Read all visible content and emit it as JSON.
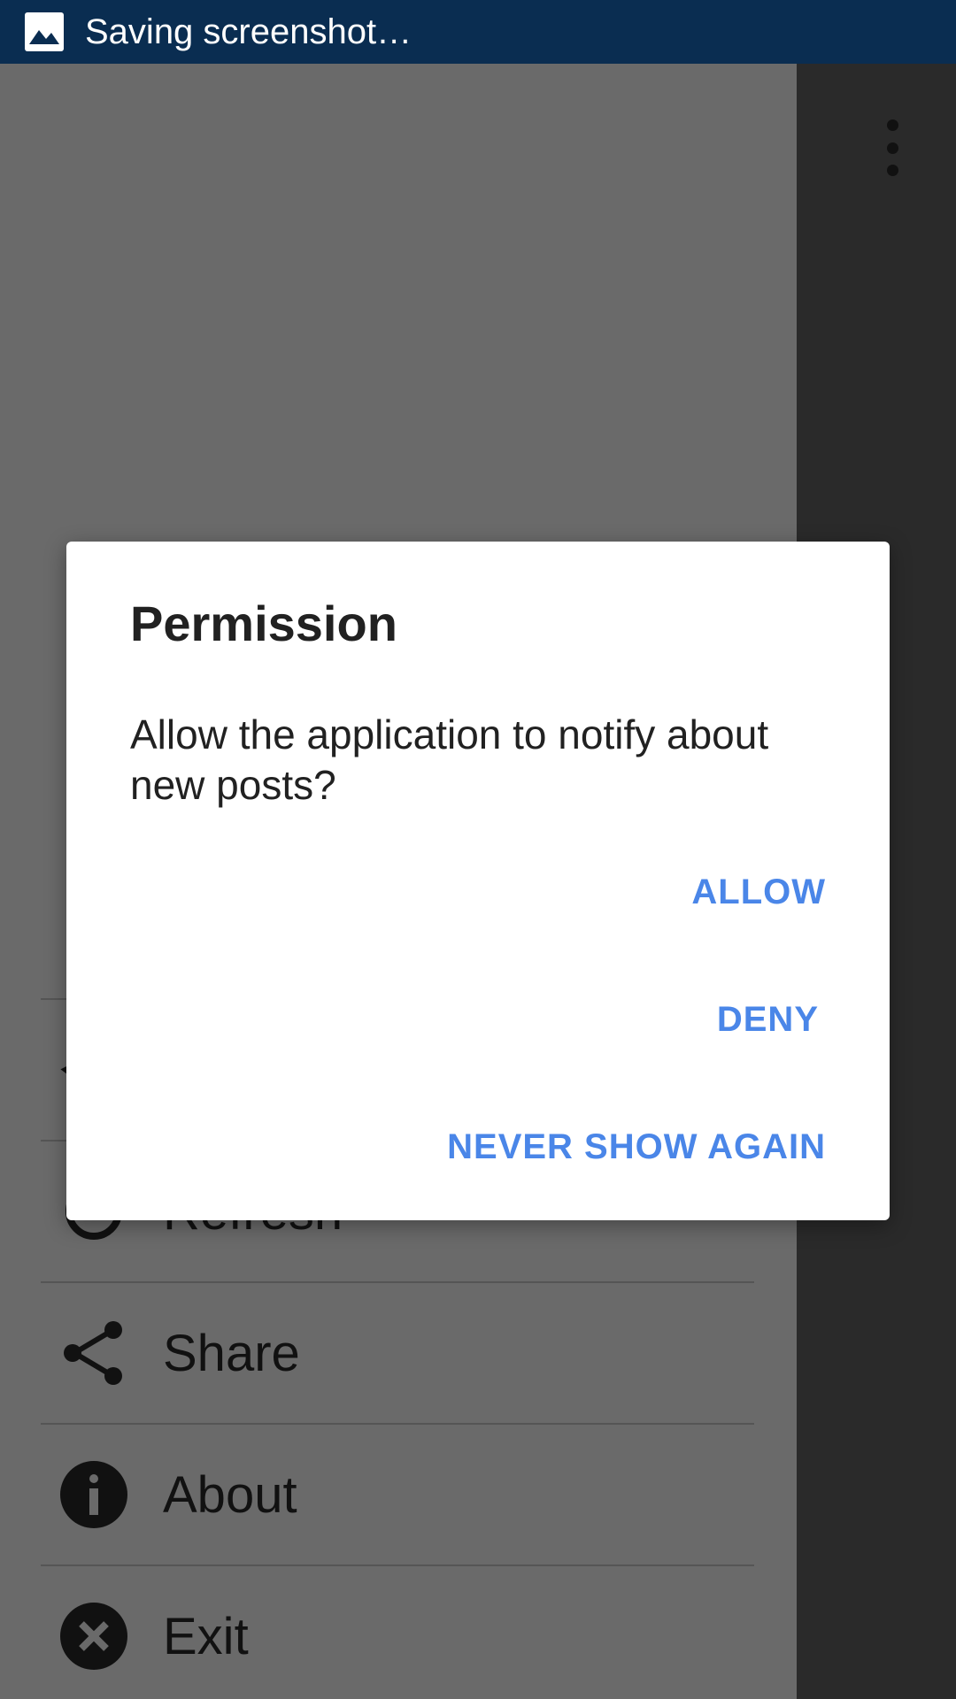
{
  "status_bar": {
    "notification_text": "Saving screenshot…",
    "icon": "image-icon",
    "background": "#0a2d51"
  },
  "toolbar": {
    "overflow_icon": "more-vert-icon"
  },
  "drawer": {
    "items": [
      {
        "label": "",
        "icon": "partial-icon"
      },
      {
        "label": "Refresh",
        "icon": "refresh-icon"
      },
      {
        "label": "Share",
        "icon": "share-icon"
      },
      {
        "label": "About",
        "icon": "info-icon"
      },
      {
        "label": "Exit",
        "icon": "close-circle-icon"
      }
    ]
  },
  "dialog": {
    "title": "Permission",
    "message": "Allow the application to notify about new posts?",
    "buttons": {
      "allow": "ALLOW",
      "deny": "DENY",
      "never": "NEVER SHOW AGAIN"
    },
    "accent": "#4a86e8"
  }
}
